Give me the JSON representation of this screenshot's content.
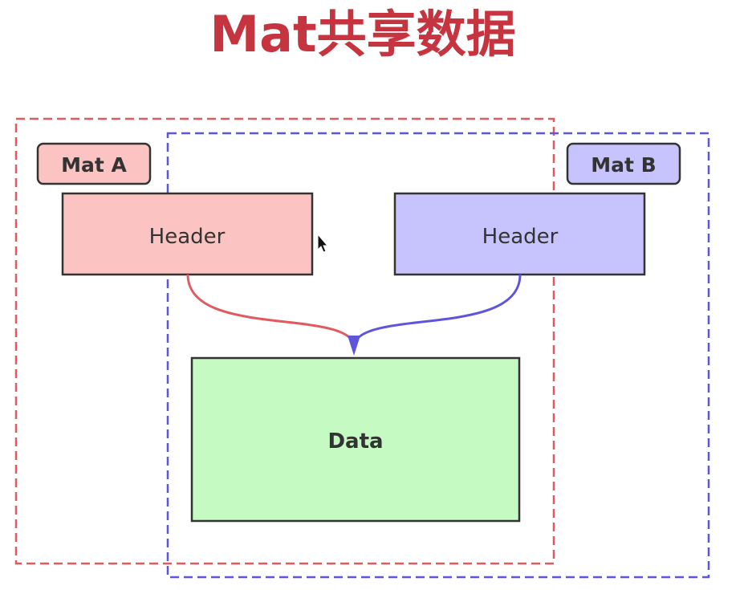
{
  "title": "Mat共享数据",
  "mat_a": {
    "label": "Mat A",
    "header_label": "Header"
  },
  "mat_b": {
    "label": "Mat B",
    "header_label": "Header"
  },
  "data_block": {
    "label": "Data"
  },
  "colors": {
    "title": "#c6353f",
    "mat_a_border": "#e05a5f",
    "mat_a_fill": "#fbc4c2",
    "mat_b_border": "#5f55dd",
    "mat_b_fill": "#c7c4fd",
    "data_fill": "#c5fbc2",
    "outline": "#333333",
    "text": "#333333",
    "cursor": "#111111"
  }
}
